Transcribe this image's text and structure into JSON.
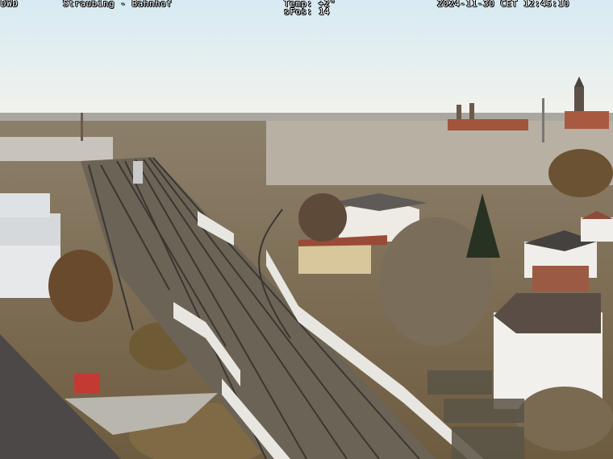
{
  "overlay": {
    "left_code": "DWD",
    "location": "Straubing - Bahnhof",
    "temp_line": "Temp: +2°",
    "sfos_line": "sFos: 14",
    "datetime": "2024-11-30 CET 12:45:10"
  },
  "colors": {
    "sky_top": "#dfeef6",
    "sky_horizon": "#f2f4ee",
    "town_roofs": "#8a4a35",
    "trees": "#5b4a32",
    "rail": "#3b3630",
    "walls": "#e8e6e0"
  }
}
